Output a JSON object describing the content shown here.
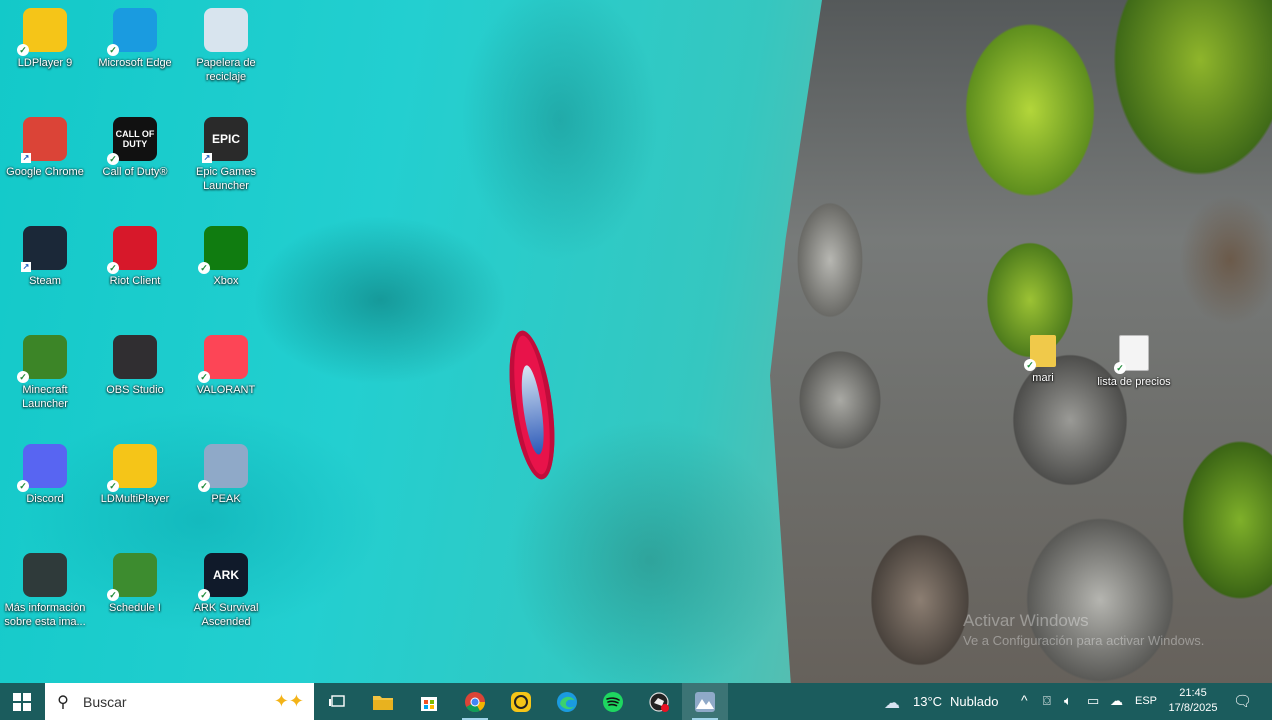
{
  "desktop": {
    "icons": [
      {
        "label": "LDPlayer 9",
        "icon": "ldplayer-icon",
        "color": "#f5c518"
      },
      {
        "label": "Microsoft Edge",
        "icon": "edge-icon",
        "color": "#1a9be0"
      },
      {
        "label": "Papelera de reciclaje",
        "icon": "recycle-bin-icon",
        "color": "#d8e4ee"
      },
      {
        "label": "Google Chrome",
        "icon": "chrome-icon",
        "color": "#db4437"
      },
      {
        "label": "Call of Duty®",
        "icon": "call-of-duty-icon",
        "color": "#111111",
        "glyph": "CALL OF DUTY"
      },
      {
        "label": "Epic Games Launcher",
        "icon": "epic-games-icon",
        "color": "#2a2a2a",
        "glyph": "EPIC"
      },
      {
        "label": "Steam",
        "icon": "steam-icon",
        "color": "#1b2838"
      },
      {
        "label": "Riot Client",
        "icon": "riot-client-icon",
        "color": "#d7182a"
      },
      {
        "label": "Xbox",
        "icon": "xbox-icon",
        "color": "#107c10"
      },
      {
        "label": "Minecraft Launcher",
        "icon": "minecraft-icon",
        "color": "#3c8527"
      },
      {
        "label": "OBS Studio",
        "icon": "obs-icon",
        "color": "#302e31"
      },
      {
        "label": "VALORANT",
        "icon": "valorant-icon",
        "color": "#fd4556"
      },
      {
        "label": "Discord",
        "icon": "discord-icon",
        "color": "#5865f2"
      },
      {
        "label": "LDMultiPlayer",
        "icon": "ldmultiplayer-icon",
        "color": "#f5c518"
      },
      {
        "label": "PEAK",
        "icon": "peak-icon",
        "color": "#8fa9c8"
      },
      {
        "label": "Más información sobre esta ima...",
        "icon": "info-camera-icon",
        "color": "#2f3a3a"
      },
      {
        "label": "Schedule I",
        "icon": "schedule-i-icon",
        "color": "#3d8c2f"
      },
      {
        "label": "ARK Survival Ascended",
        "icon": "ark-icon",
        "color": "#101a2a",
        "glyph": "ARK"
      },
      {
        "label": "mari",
        "icon": "folder-icon",
        "color": "#f0c94a"
      },
      {
        "label": "lista de precios",
        "icon": "chrome-html-file-icon",
        "color": "#f4f4f4"
      }
    ]
  },
  "watermark": {
    "line1": "Activar Windows",
    "line2": "Ve a Configuración para activar Windows."
  },
  "taskbar": {
    "search_placeholder": "Buscar",
    "apps": [
      {
        "name": "task-view",
        "icon": "task-view-icon"
      },
      {
        "name": "file-explorer",
        "icon": "file-explorer-icon"
      },
      {
        "name": "microsoft-store",
        "icon": "store-icon"
      },
      {
        "name": "google-chrome",
        "icon": "chrome-icon"
      },
      {
        "name": "ldplayer",
        "icon": "ldplayer-icon"
      },
      {
        "name": "microsoft-edge",
        "icon": "edge-icon"
      },
      {
        "name": "spotify",
        "icon": "spotify-icon"
      },
      {
        "name": "riot-client",
        "icon": "riot-client-icon"
      },
      {
        "name": "peak",
        "icon": "peak-icon"
      }
    ],
    "weather": {
      "temp": "13°C",
      "condition": "Nublado"
    },
    "language": "ESP",
    "time": "21:45",
    "date": "17/8/2025"
  }
}
